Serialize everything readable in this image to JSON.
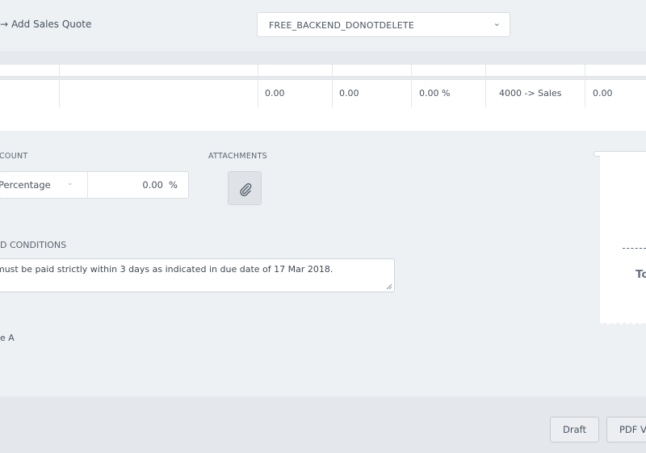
{
  "header": {
    "back_arrow": "→",
    "back_label": "Add Sales Quote",
    "organization_select": {
      "value": "FREE_BACKEND_DONOTDELETE",
      "chevron": "⌄"
    }
  },
  "line_items": {
    "rows": [
      {
        "col3": "0.00",
        "col4": "0.00",
        "col5": "0.00 %",
        "account": "4000 -> Sales",
        "col7": "0.00"
      }
    ]
  },
  "discount": {
    "label": "COUNT",
    "type_value": "Percentage",
    "type_chevron": "⌄",
    "amount": "0.00",
    "unit": "%"
  },
  "attachments": {
    "label": "ATTACHMENTS",
    "icon": "paperclip-icon"
  },
  "terms": {
    "label": "D CONDITIONS",
    "text": "must be paid strictly within 3 days as indicated in due date of 17 Mar 2018."
  },
  "note": "e A",
  "summary": {
    "total_label": "To"
  },
  "footer": {
    "draft_label": "Draft",
    "pdf_label": "PDF V"
  }
}
